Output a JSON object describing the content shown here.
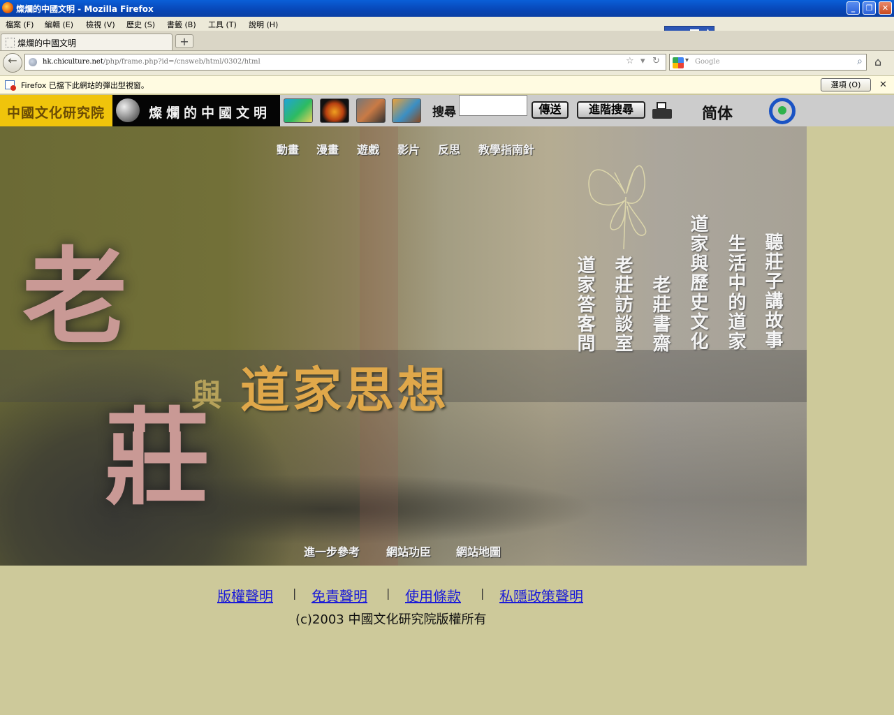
{
  "window": {
    "title": "燦爛的中國文明 - Mozilla Firefox",
    "controls": {
      "minimize": "_",
      "maximize": "❐",
      "close": "✕"
    }
  },
  "menubar": {
    "items": [
      "檔案 (F)",
      "編輯 (E)",
      "檢視 (V)",
      "歷史 (S)",
      "書籤 (B)",
      "工具 (T)",
      "說明 (H)"
    ]
  },
  "ime": {
    "help_label": "?",
    "arrows": "▲\n▼"
  },
  "tabs": {
    "active_label": "燦爛的中國文明",
    "new_tab_label": "+"
  },
  "navigation": {
    "back_label": "←",
    "url_domain": "hk.chiculture.net",
    "url_path": "/php/frame.php?id=/cnsweb/html/0302/html",
    "bookmark_star": "☆",
    "dropdown": "▾",
    "reload": "↻",
    "search_placeholder": "Google",
    "search_engine_dropdown": "▾",
    "search_icon": "⌕",
    "home_icon": "⌂"
  },
  "popup_notification": {
    "message": "Firefox 已擋下此網站的彈出型視窗。",
    "options_label": "選項 (O)",
    "close_label": "✕"
  },
  "site_header": {
    "org_logo": "中國文化研究院",
    "site_logo": "燦爛的中國文明",
    "search_label": "搜尋",
    "search_value": "",
    "submit_label": "傳送",
    "advanced_label": "進階搜尋",
    "simplified_label": "简体"
  },
  "banner": {
    "top_nav": [
      "動畫",
      "漫畫",
      "遊戲",
      "影片",
      "反思",
      "教學指南針"
    ],
    "title_lao": "老",
    "title_zhuang": "莊",
    "title_yu": "與",
    "title_daojia": "道家思想",
    "sections": [
      "聽莊子講故事",
      "生活中的道家",
      "道家與歷史文化",
      "老莊書齋",
      "老莊訪談室",
      "道家答客問"
    ],
    "bottom_nav": [
      "進一步參考",
      "網站功臣",
      "網站地圖"
    ]
  },
  "footer": {
    "links": [
      "版權聲明",
      "免責聲明",
      "使用條款",
      "私隱政策聲明"
    ],
    "separator": "|",
    "copyright": "(c)2003 中國文化研究院版權所有"
  }
}
